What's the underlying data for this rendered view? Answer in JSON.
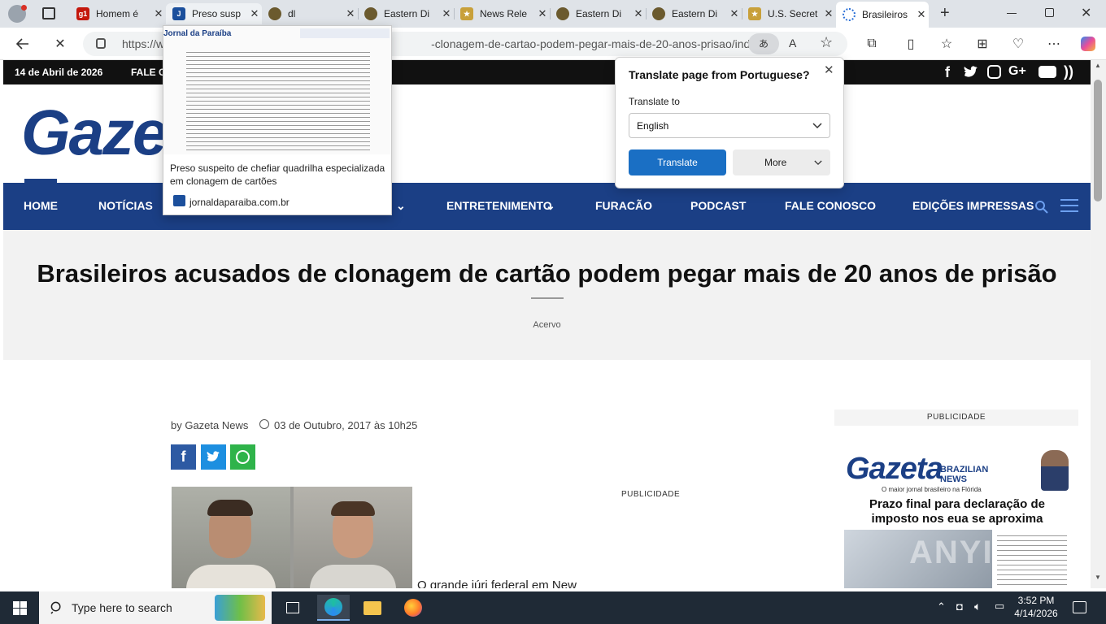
{
  "browser": {
    "tabs": [
      {
        "title": "Homem é",
        "favicon": "g1",
        "color": "#c4170c"
      },
      {
        "title": "Preso susp",
        "favicon": "jornal",
        "color": "#1b4f9c"
      },
      {
        "title": "dl",
        "favicon": "seal",
        "color": "#6b5a2e"
      },
      {
        "title": "Eastern Di",
        "favicon": "seal",
        "color": "#6b5a2e"
      },
      {
        "title": "News Rele",
        "favicon": "star",
        "color": "#c8a03a"
      },
      {
        "title": "Eastern Di",
        "favicon": "seal",
        "color": "#6b5a2e"
      },
      {
        "title": "Eastern Di",
        "favicon": "seal",
        "color": "#6b5a2e"
      },
      {
        "title": "U.S. Secret",
        "favicon": "star",
        "color": "#c8a03a"
      },
      {
        "title": "Brasileiros",
        "favicon": "loading",
        "color": "#2a6fd6"
      }
    ],
    "url_left": "https://w",
    "url_right": "-clonagem-de-cartao-podem-pegar-mais-de-20-anos-prisao/index...."
  },
  "preview": {
    "thumb_brand": "Jornal da Paraíba",
    "title": "Preso suspeito de chefiar quadrilha especializada em clonagem de cartões",
    "site": "jornaldaparaiba.com.br"
  },
  "translate": {
    "heading": "Translate page from Portuguese?",
    "translate_to_label": "Translate to",
    "language": "English",
    "translate_button": "Translate",
    "more_button": "More"
  },
  "site": {
    "date": "14 de Abril de 2026",
    "contact_short": "FALE C",
    "logo": "Gazet",
    "menu": {
      "home": "HOME",
      "noticias": "NOTÍCIAS",
      "entretenimento": "ENTRETENIMENTO",
      "furacao": "FURACÃO",
      "podcast": "PODCAST",
      "fale_conosco": "FALE CONOSCO",
      "edicoes": "EDIÇÕES IMPRESSAS"
    },
    "headline": "Brasileiros acusados de clonagem de cartão podem pegar mais de 20 anos de prisão",
    "photo_credit": "Acervo",
    "byline": "by Gazeta News",
    "dateline": "03 de Outubro, 2017 às 10h25",
    "ad_label_center": "PUBLICIDADE",
    "ad_label_side": "PUBLICIDADE",
    "body_start": "O grande júri federal em New",
    "ad": {
      "logo": "Gazeta",
      "logo_sub": "BRAZILIAN NEWS",
      "tagline": "O maior jornal brasileiro na Flórida",
      "headline": "Prazo final para declaração de imposto nos eua se aproxima",
      "watermark": "ANYIK"
    }
  },
  "taskbar": {
    "search_placeholder": "Type here to search",
    "time": "3:52 PM",
    "date": "4/14/2026"
  }
}
